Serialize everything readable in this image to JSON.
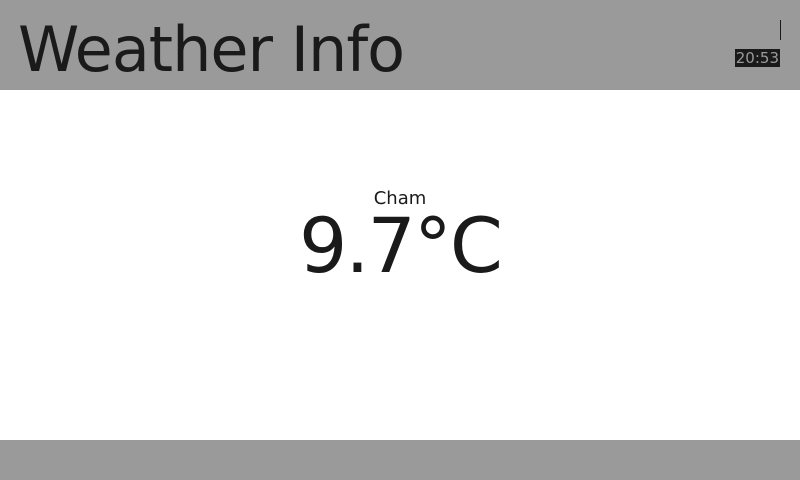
{
  "header": {
    "title": "Weather Info",
    "clock": "20:53"
  },
  "main": {
    "location": "Cham",
    "temperature": "9.7°C"
  },
  "colors": {
    "bar_background": "#9a9a9a",
    "content_background": "#ffffff",
    "text": "#1a1a1a"
  }
}
